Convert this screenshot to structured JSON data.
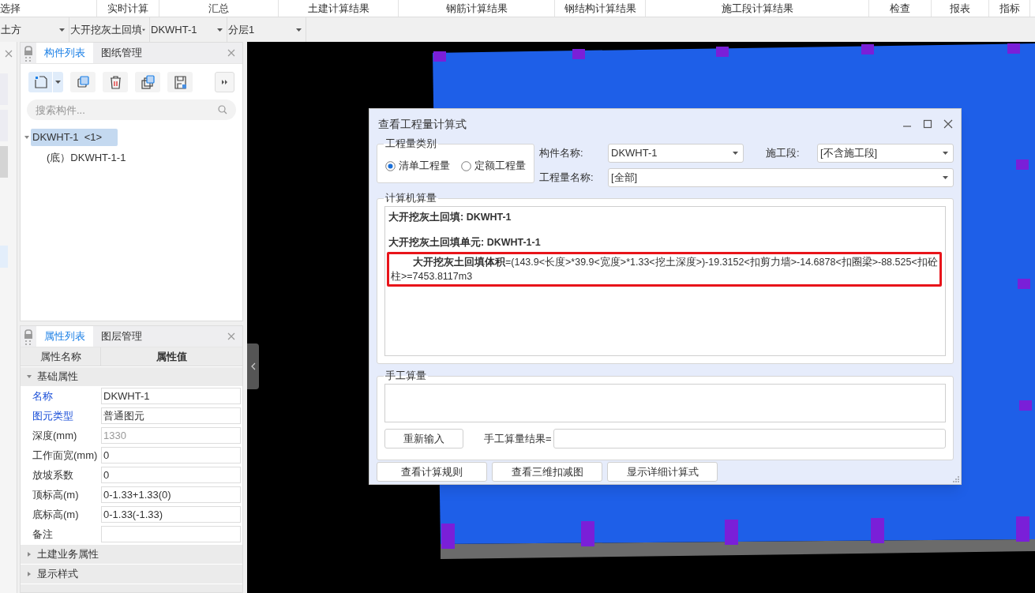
{
  "menu": [
    "选择",
    "实时计算",
    "汇总",
    "土建计算结果",
    "钢筋计算结果",
    "钢结构计算结果",
    "施工段计算结果",
    "检查",
    "报表",
    "指标"
  ],
  "toolbar": {
    "dropdowns": [
      "土方",
      "大开挖灰土回填",
      "DKWHT-1",
      "分层1"
    ]
  },
  "component_panel": {
    "tabs": [
      {
        "label": "构件列表",
        "selected": true
      },
      {
        "label": "图纸管理",
        "selected": false
      }
    ],
    "search": {
      "placeholder": "搜索构件..."
    },
    "tree": [
      {
        "label": "DKWHT-1  <1>",
        "selected": true,
        "expanded": true,
        "children": [
          {
            "label": "(底）DKWHT-1-1",
            "selected": false
          }
        ]
      }
    ]
  },
  "property_panel": {
    "tabs": [
      {
        "label": "属性列表",
        "selected": true
      },
      {
        "label": "图层管理",
        "selected": false
      }
    ],
    "columns": [
      "属性名称",
      "属性值"
    ],
    "groups": [
      {
        "label": "基础属性",
        "expanded": true,
        "rows": [
          {
            "name": "名称",
            "value": "DKWHT-1",
            "public": true,
            "disabled": false
          },
          {
            "name": "图元类型",
            "value": "普通图元",
            "public": true,
            "disabled": false
          },
          {
            "name": "深度(mm)",
            "value": "1330",
            "public": false,
            "disabled": true
          },
          {
            "name": "工作面宽(mm)",
            "value": "0",
            "public": false,
            "disabled": false
          },
          {
            "name": "放坡系数",
            "value": "0",
            "public": false,
            "disabled": false
          },
          {
            "name": "顶标高(m)",
            "value": "0-1.33+1.33(0)",
            "public": false,
            "disabled": false
          },
          {
            "name": "底标高(m)",
            "value": "0-1.33(-1.33)",
            "public": false,
            "disabled": false
          },
          {
            "name": "备注",
            "public": false,
            "disabled": false
          }
        ]
      },
      {
        "label": "土建业务属性",
        "expanded": false
      },
      {
        "label": "显示样式",
        "expanded": false
      }
    ]
  },
  "dialog": {
    "title": "查看工程量计算式",
    "quantity_type": {
      "label": "工程量类别",
      "options": [
        {
          "label": "清单工程量",
          "selected": true
        },
        {
          "label": "定额工程量",
          "selected": false
        }
      ]
    },
    "fields": [
      {
        "label": "构件名称:",
        "value": "DKWHT-1"
      },
      {
        "label": "施工段:",
        "value": "[不含施工段]"
      },
      {
        "label": "工程量名称:",
        "value": "[全部]"
      }
    ],
    "computed": {
      "label": "计算机算量",
      "lines": [
        {
          "kind": "heading",
          "text": "大开挖灰土回填: DKWHT-1"
        },
        {
          "kind": "heading",
          "text": "大开挖灰土回填单元: DKWHT-1-1"
        },
        {
          "kind": "formula",
          "text": "**大开挖灰土回填体积**=(143.9<长度>*39.9<宽度>*1.33<挖土深度>)-19.3152<扣剪力墙>-14.6878<扣圈梁>-88.525<扣砼柱>=7453.8117m3"
        }
      ]
    },
    "manual": {
      "label": "手工算量",
      "reset_button": "重新输入",
      "result_label": "手工算量结果="
    },
    "buttons": [
      "查看计算规则",
      "查看三维扣减图",
      "显示详细计算式"
    ]
  }
}
